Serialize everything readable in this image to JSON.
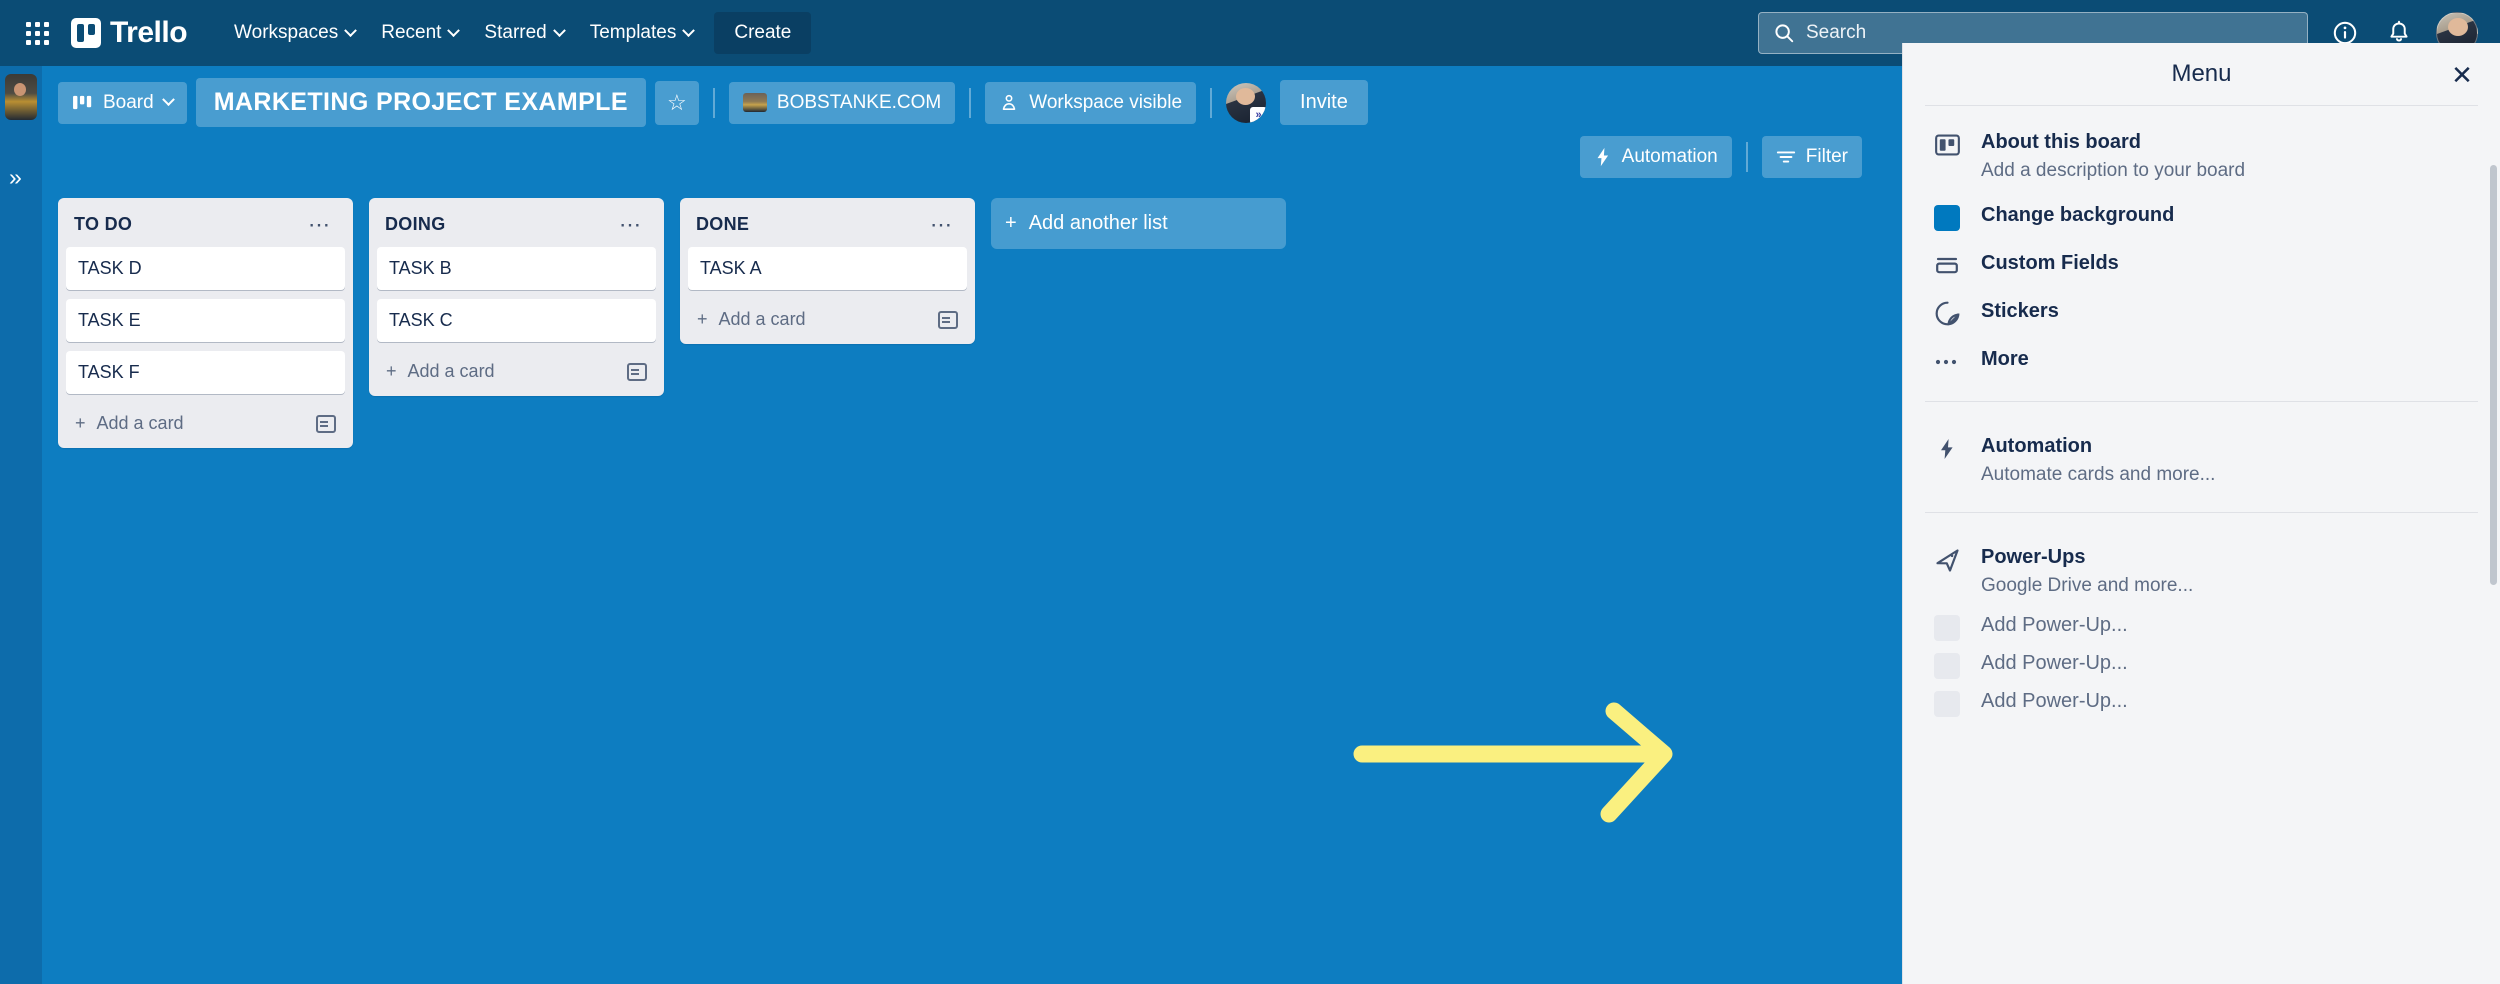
{
  "topnav": {
    "apps_icon": "apps-grid-icon",
    "brand": "Trello",
    "items": [
      {
        "label": "Workspaces",
        "has_chevron": true
      },
      {
        "label": "Recent",
        "has_chevron": true
      },
      {
        "label": "Starred",
        "has_chevron": true
      },
      {
        "label": "Templates",
        "has_chevron": true
      }
    ],
    "create_label": "Create",
    "search_placeholder": "Search",
    "info_icon": "info-circle-icon",
    "bell_icon": "notification-bell-icon",
    "avatar": "user-avatar"
  },
  "left_rail": {
    "board_thumbnail": "board-thumbnail",
    "expand_label": "»"
  },
  "board_header": {
    "view_label": "Board",
    "view_icon": "board-view-icon",
    "title": "MARKETING PROJECT EXAMPLE",
    "star_icon": "☆",
    "workspace_label": "BOBSTANKE.COM",
    "visibility_label": "Workspace visible",
    "visibility_icon": "workspace-visible-icon",
    "member_avatar": "member-avatar",
    "invite_label": "Invite",
    "automation_label": "Automation",
    "automation_icon": "lightning-bolt-icon",
    "filter_label": "Filter",
    "filter_icon": "filter-icon"
  },
  "board": {
    "lists": [
      {
        "title": "TO DO",
        "cards": [
          "TASK D",
          "TASK E",
          "TASK F"
        ],
        "add_card_label": "Add a card",
        "menu_icon": "list-actions-icon",
        "template_icon": "card-template-icon"
      },
      {
        "title": "DOING",
        "cards": [
          "TASK B",
          "TASK C"
        ],
        "add_card_label": "Add a card",
        "menu_icon": "list-actions-icon",
        "template_icon": "card-template-icon"
      },
      {
        "title": "DONE",
        "cards": [
          "TASK A"
        ],
        "add_card_label": "Add a card",
        "menu_icon": "list-actions-icon",
        "template_icon": "card-template-icon"
      }
    ],
    "add_list_label": "Add another list"
  },
  "annotation": {
    "arrow": "yellow-right-arrow",
    "color": "#faf080"
  },
  "menu": {
    "title": "Menu",
    "close_icon": "close-icon",
    "groups": [
      {
        "rows": [
          {
            "label": "About this board",
            "sub": "Add a description to your board",
            "icon": "board-icon",
            "bold": true
          },
          {
            "label": "Change background",
            "sub": "",
            "icon": "background-swatch-icon",
            "bold": true
          },
          {
            "label": "Custom Fields",
            "sub": "",
            "icon": "custom-fields-icon",
            "bold": true
          },
          {
            "label": "Stickers",
            "sub": "",
            "icon": "sticker-icon",
            "bold": true
          },
          {
            "label": "More",
            "sub": "",
            "icon": "more-dots-icon",
            "bold": true
          }
        ]
      },
      {
        "rows": [
          {
            "label": "Automation",
            "sub": "Automate cards and more...",
            "icon": "lightning-bolt-icon",
            "bold": true
          }
        ]
      },
      {
        "rows": [
          {
            "label": "Power-Ups",
            "sub": "Google Drive and more...",
            "icon": "rocket-icon",
            "bold": true
          },
          {
            "label": "Add Power-Up...",
            "sub": "",
            "icon": "empty-swatch-icon",
            "bold": false
          },
          {
            "label": "Add Power-Up...",
            "sub": "",
            "icon": "empty-swatch-icon",
            "bold": false
          },
          {
            "label": "Add Power-Up...",
            "sub": "",
            "icon": "empty-swatch-icon",
            "bold": false
          }
        ]
      }
    ]
  },
  "colors": {
    "topnav_bg": "#0b4c75",
    "board_bg": "#0d7dc1",
    "list_bg": "#ebecf0",
    "accent": "#0079bf",
    "annotation_yellow": "#faf080"
  }
}
